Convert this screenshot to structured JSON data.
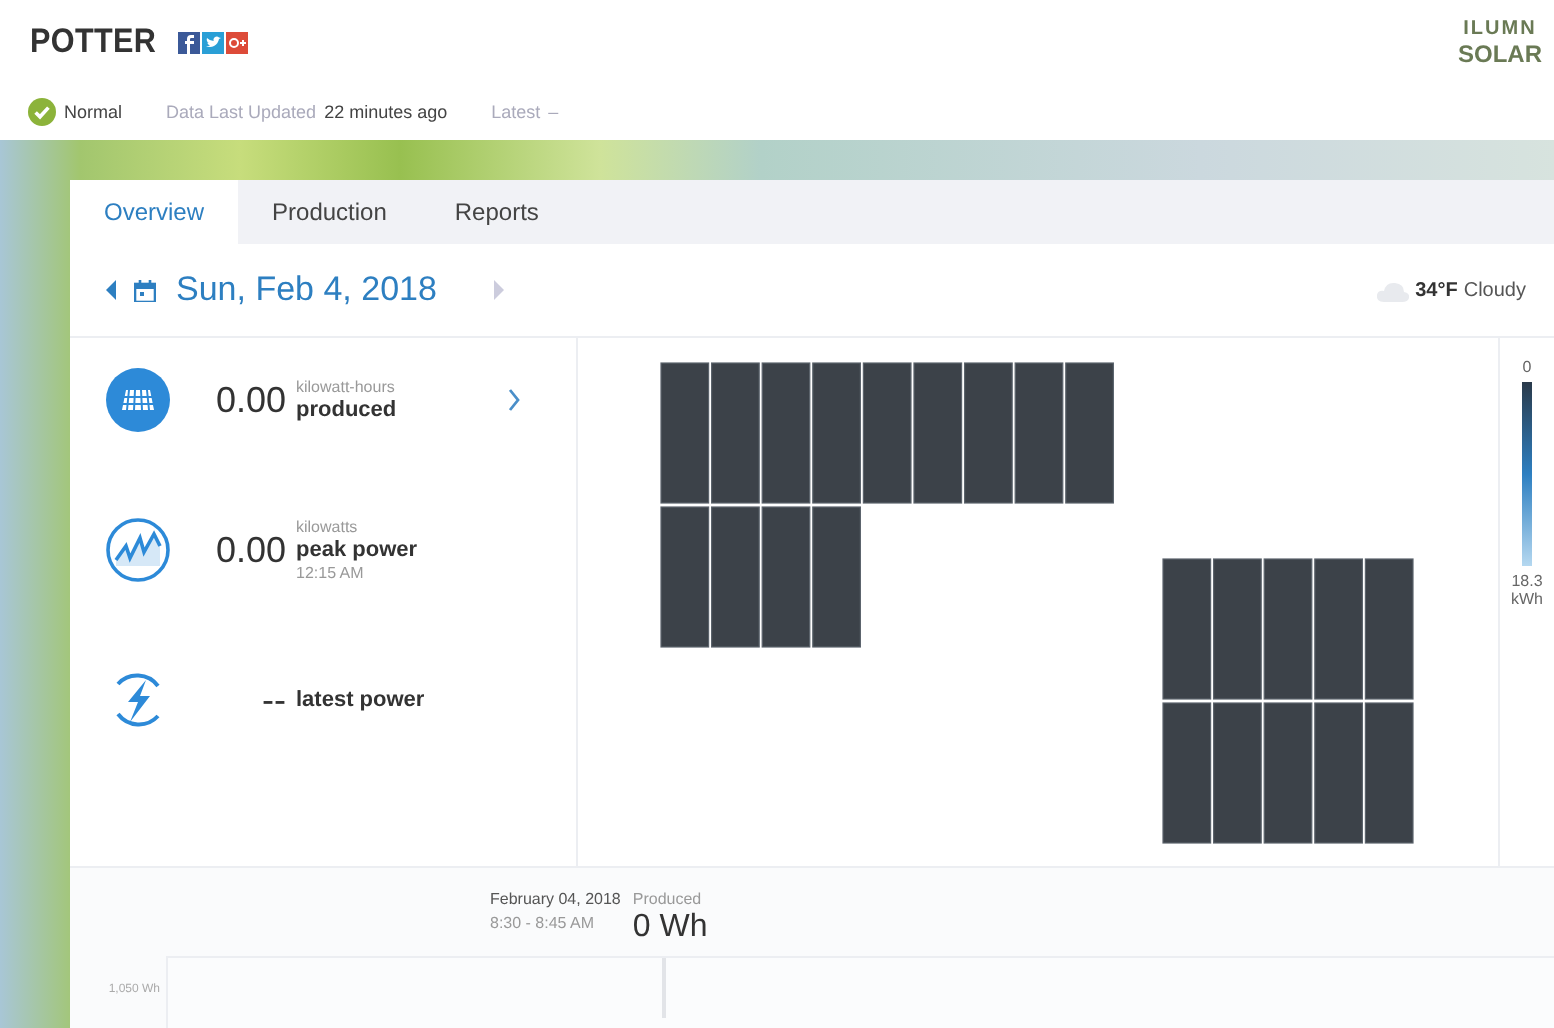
{
  "site": {
    "title": "POTTER",
    "logo_lines": [
      "ILUMN",
      "SOLAR"
    ]
  },
  "status": {
    "label": "Normal",
    "ok": true,
    "updated_label": "Data Last Updated",
    "updated_value": "22 minutes ago",
    "latest_label": "Latest",
    "latest_value": "–"
  },
  "tabs": [
    {
      "label": "Overview",
      "selected": true
    },
    {
      "label": "Production",
      "selected": false
    },
    {
      "label": "Reports",
      "selected": false
    }
  ],
  "date_nav": {
    "date": "Sun, Feb 4, 2018"
  },
  "weather": {
    "temperature": "34°F",
    "condition": "Cloudy"
  },
  "stats": [
    {
      "kind": "produced",
      "value": "0.00",
      "unit": "kilowatt-hours",
      "label": "produced",
      "link": true
    },
    {
      "kind": "peak",
      "value": "0.00",
      "unit": "kilowatts",
      "label": "peak power",
      "time": "12:15 AM",
      "link": false
    },
    {
      "kind": "latest",
      "value": "--",
      "label": "latest power",
      "link": false
    }
  ],
  "legend": {
    "max_label": "0",
    "min_label": "18.3 kWh"
  },
  "chart_header": {
    "date": "February 04, 2018",
    "range": "8:30 - 8:45 AM",
    "produced_label": "Produced",
    "produced_value": "0 Wh"
  },
  "chart": {
    "y_label": "1,050 Wh"
  }
}
